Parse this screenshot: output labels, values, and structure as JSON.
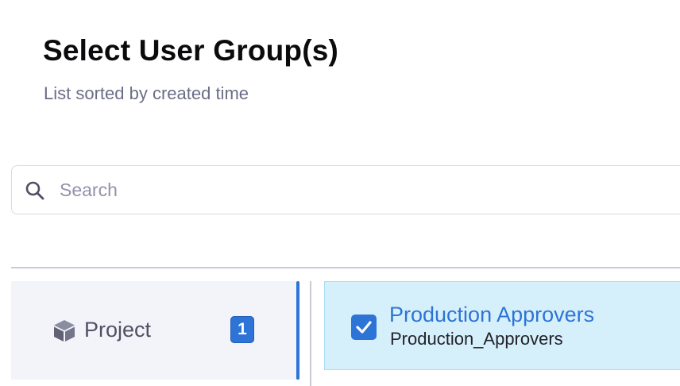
{
  "header": {
    "title": "Select User Group(s)",
    "subtitle": "List sorted by created time"
  },
  "search": {
    "placeholder": "Search",
    "value": "",
    "icon": "search-icon"
  },
  "scopes": [
    {
      "label": "Project",
      "count": "1",
      "icon": "cube-icon",
      "active": true
    }
  ],
  "user_groups": [
    {
      "name": "Production Approvers",
      "identifier": "Production_Approvers",
      "checked": true
    }
  ],
  "colors": {
    "accent": "#2d74d6",
    "selected_row_bg": "#d6f0fb",
    "scope_panel_bg": "#f3f3fa",
    "muted_text": "#6b6d85"
  }
}
